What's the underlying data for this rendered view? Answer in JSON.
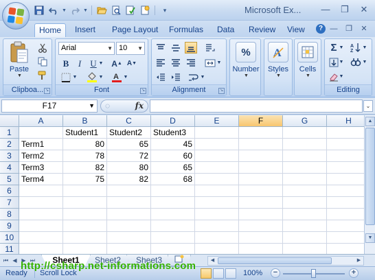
{
  "window": {
    "title": "Microsoft Ex...",
    "minimize": "—",
    "restore": "❐",
    "close": "✕"
  },
  "qat": {
    "icons": [
      "save-icon",
      "undo-icon",
      "redo-icon",
      "open-icon",
      "print-preview-icon",
      "spelling-icon",
      "new-icon"
    ]
  },
  "tabs": [
    {
      "label": "Home",
      "active": true
    },
    {
      "label": "Insert"
    },
    {
      "label": "Page Layout"
    },
    {
      "label": "Formulas"
    },
    {
      "label": "Data"
    },
    {
      "label": "Review"
    },
    {
      "label": "View"
    }
  ],
  "ribbon": {
    "clipboard": {
      "label": "Clipboa...",
      "paste": "Paste"
    },
    "font": {
      "label": "Font",
      "font_name": "Arial",
      "font_size": "10"
    },
    "alignment": {
      "label": "Alignment"
    },
    "number": {
      "label": "Number"
    },
    "styles": {
      "label": "Styles"
    },
    "cells": {
      "label": "Cells"
    },
    "editing": {
      "label": "Editing"
    }
  },
  "formula_bar": {
    "name_box": "F17",
    "fx": "fx",
    "formula": ""
  },
  "grid": {
    "columns": [
      "A",
      "B",
      "C",
      "D",
      "E",
      "F",
      "G",
      "H"
    ],
    "selected_column": "F",
    "rows": [
      [
        "",
        "Student1",
        "Student2",
        "Student3",
        "",
        "",
        "",
        ""
      ],
      [
        "Term1",
        "80",
        "65",
        "45",
        "",
        "",
        "",
        ""
      ],
      [
        "Term2",
        "78",
        "72",
        "60",
        "",
        "",
        "",
        ""
      ],
      [
        "Term3",
        "82",
        "80",
        "65",
        "",
        "",
        "",
        ""
      ],
      [
        "Term4",
        "75",
        "82",
        "68",
        "",
        "",
        "",
        ""
      ],
      [
        "",
        "",
        "",
        "",
        "",
        "",
        "",
        ""
      ],
      [
        "",
        "",
        "",
        "",
        "",
        "",
        "",
        ""
      ],
      [
        "",
        "",
        "",
        "",
        "",
        "",
        "",
        ""
      ],
      [
        "",
        "",
        "",
        "",
        "",
        "",
        "",
        ""
      ],
      [
        "",
        "",
        "",
        "",
        "",
        "",
        "",
        ""
      ],
      [
        "",
        "",
        "",
        "",
        "",
        "",
        "",
        ""
      ]
    ],
    "row_numbers": [
      "1",
      "2",
      "3",
      "4",
      "5",
      "6",
      "7",
      "8",
      "9",
      "10",
      "11"
    ]
  },
  "sheets": [
    {
      "label": "Sheet1",
      "active": true
    },
    {
      "label": "Sheet2"
    },
    {
      "label": "Sheet3"
    }
  ],
  "status": {
    "ready": "Ready",
    "scroll_lock": "Scroll Lock",
    "zoom": "100%"
  },
  "watermark": "http://csharp.net-informations.com"
}
